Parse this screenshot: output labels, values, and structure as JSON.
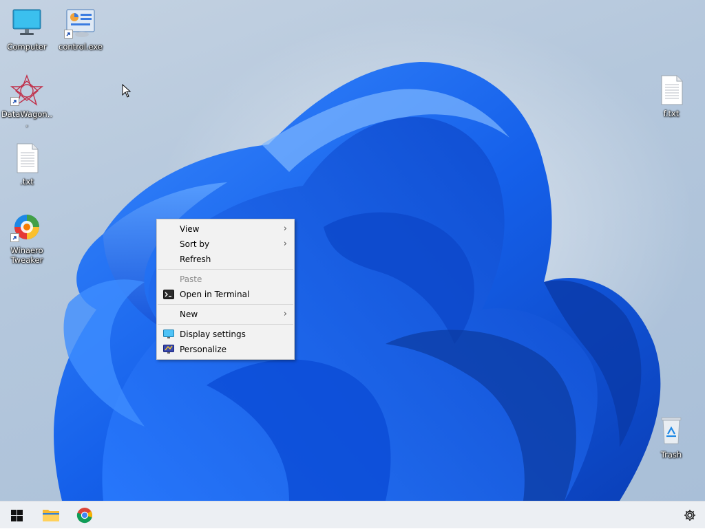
{
  "desktop": {
    "icons": [
      {
        "id": "computer",
        "label": "Computer"
      },
      {
        "id": "control",
        "label": "control.exe"
      },
      {
        "id": "datawagon",
        "label": "DataWagon..."
      },
      {
        "id": "txt",
        "label": ".txt"
      },
      {
        "id": "winaero",
        "label": "Winaero Tweaker"
      },
      {
        "id": "ftxt",
        "label": "f.txt"
      },
      {
        "id": "trash",
        "label": "Trash"
      }
    ]
  },
  "context_menu": {
    "items": [
      {
        "label": "View",
        "submenu": true
      },
      {
        "label": "Sort by",
        "submenu": true
      },
      {
        "label": "Refresh"
      },
      {
        "label": "Paste",
        "disabled": true
      },
      {
        "label": "Open in Terminal",
        "icon": "terminal-icon"
      },
      {
        "label": "New",
        "submenu": true
      },
      {
        "label": "Display settings",
        "icon": "display-icon"
      },
      {
        "label": "Personalize",
        "icon": "personalize-icon"
      }
    ],
    "chevron": "›"
  },
  "taskbar": {
    "start": "windows-start-icon",
    "pinned": [
      "file-explorer-icon",
      "chrome-icon"
    ],
    "tray": "gear-icon"
  },
  "colors": {
    "menu_bg": "#f2f2f2",
    "taskbar_bg": "#eceff3",
    "wallpaper_blue": "#1a5fe6"
  }
}
